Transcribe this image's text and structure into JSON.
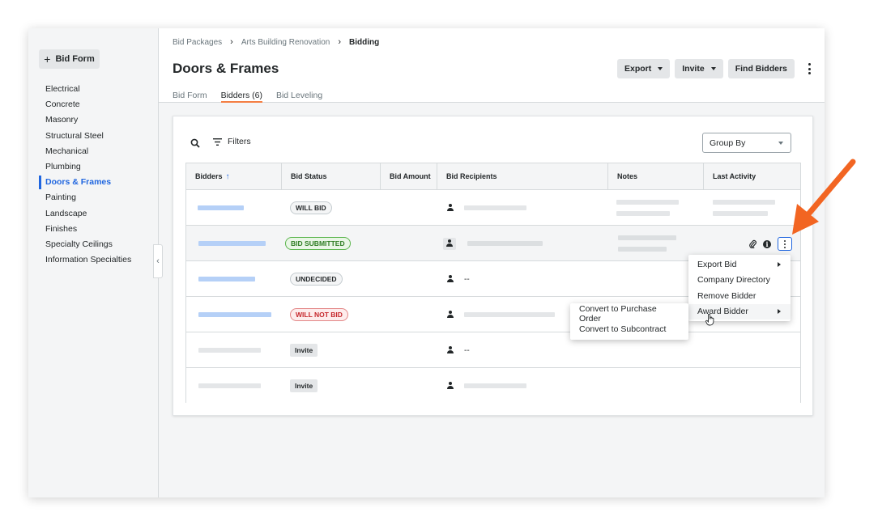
{
  "sidebar": {
    "bid_form_button": "Bid Form",
    "items": [
      "Electrical",
      "Concrete",
      "Masonry",
      "Structural Steel",
      "Mechanical",
      "Plumbing",
      "Doors & Frames",
      "Painting",
      "Landscape",
      "Finishes",
      "Specialty Ceilings",
      "Information Specialties"
    ],
    "active_index": 6
  },
  "breadcrumb": [
    "Bid Packages",
    "Arts Building Renovation",
    "Bidding"
  ],
  "page_title": "Doors & Frames",
  "header_buttons": {
    "export": "Export",
    "invite": "Invite",
    "find_bidders": "Find Bidders"
  },
  "tabs": [
    {
      "label": "Bid Form",
      "active": false
    },
    {
      "label": "Bidders (6)",
      "active": true
    },
    {
      "label": "Bid Leveling",
      "active": false
    }
  ],
  "toolbar": {
    "filters_label": "Filters",
    "group_by_label": "Group By"
  },
  "table": {
    "columns": [
      "Bidders",
      "Bid Status",
      "Bid Amount",
      "Bid Recipients",
      "Notes",
      "Last Activity"
    ],
    "sorted_column": "Bidders",
    "rows": [
      {
        "status": "WILL BID",
        "status_kind": "neutral",
        "recipient": ""
      },
      {
        "status": "BID SUBMITTED",
        "status_kind": "green",
        "recipient": ""
      },
      {
        "status": "UNDECIDED",
        "status_kind": "neutral",
        "recipient": "--"
      },
      {
        "status": "WILL NOT BID",
        "status_kind": "red",
        "recipient": ""
      },
      {
        "status": "Invite",
        "status_kind": "invite",
        "recipient": "--"
      },
      {
        "status": "Invite",
        "status_kind": "invite",
        "recipient": ""
      }
    ]
  },
  "row_menu": {
    "items": [
      {
        "label": "Export Bid",
        "has_submenu": true
      },
      {
        "label": "Company Directory",
        "has_submenu": false
      },
      {
        "label": "Remove Bidder",
        "has_submenu": false
      },
      {
        "label": "Award Bidder",
        "has_submenu": true
      }
    ]
  },
  "award_submenu": {
    "items": [
      "Convert to Purchase Order",
      "Convert to Subcontract"
    ]
  },
  "colors": {
    "accent_blue": "#2066df",
    "tab_underline": "#f47e42",
    "annotation_arrow": "#f26522"
  }
}
